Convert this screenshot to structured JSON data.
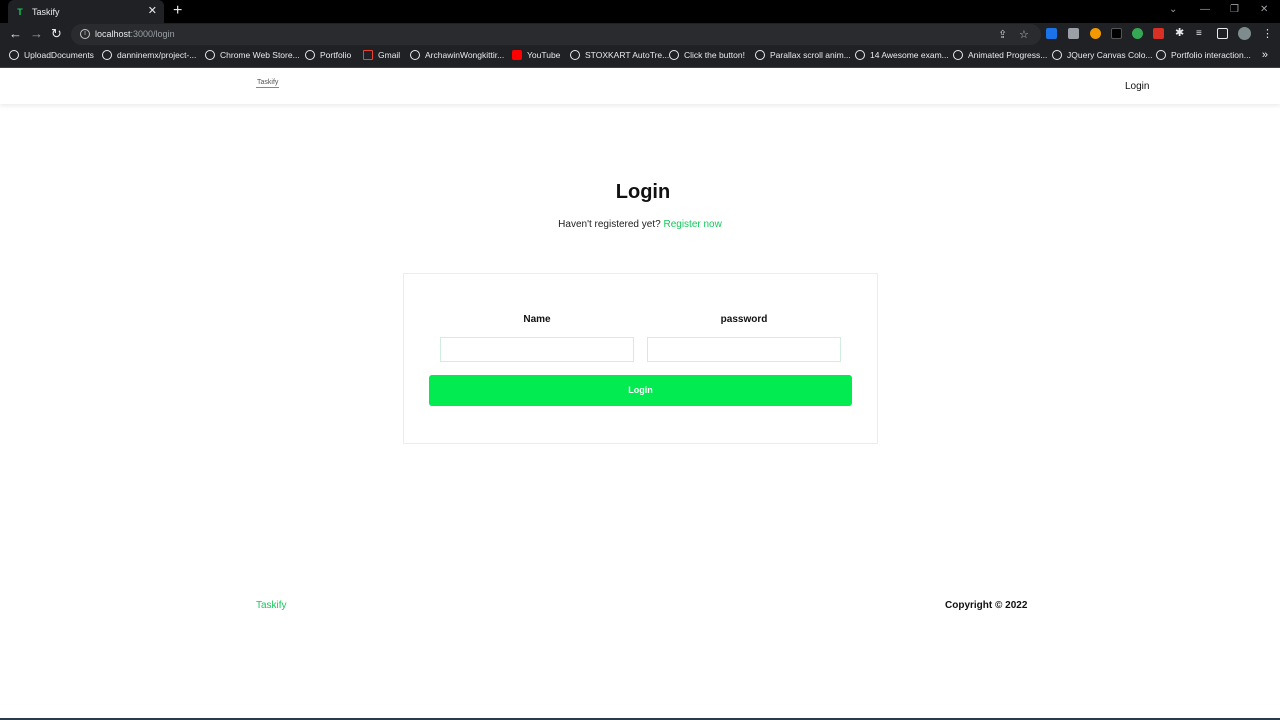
{
  "browser": {
    "tab_title": "Taskify",
    "tab_favicon": "T",
    "tab_close": "✕",
    "new_tab": "+",
    "url_host": "localhost",
    "url_path": ":3000/login",
    "bookmarks": [
      {
        "label": "UploadDocuments",
        "icon": "puzzle-icon"
      },
      {
        "label": "danninemx/project-...",
        "icon": "github-icon"
      },
      {
        "label": "Chrome Web Store...",
        "icon": "store-icon"
      },
      {
        "label": "Portfolio",
        "icon": "page-icon"
      },
      {
        "label": "Gmail",
        "icon": "gmail-icon"
      },
      {
        "label": "ArchawinWongkittir...",
        "icon": "github-icon"
      },
      {
        "label": "YouTube",
        "icon": "youtube-icon"
      },
      {
        "label": "STOXKART AutoTre...",
        "icon": "stoxkart-icon"
      },
      {
        "label": "Click the button!",
        "icon": "page-icon"
      },
      {
        "label": "Parallax scroll anim...",
        "icon": "page-icon"
      },
      {
        "label": "14 Awesome exam...",
        "icon": "page-icon"
      },
      {
        "label": "Animated Progress...",
        "icon": "page-icon"
      },
      {
        "label": "JQuery Canvas Colo...",
        "icon": "page-icon"
      },
      {
        "label": "Portfolio interaction...",
        "icon": "page-icon"
      }
    ],
    "more_bookmarks": "»"
  },
  "nav": {
    "logo_text": "Taskify",
    "login_link": "Login"
  },
  "main": {
    "title": "Login",
    "subtitle_prefix": "Haven't registered yet?",
    "register_link": "Register now",
    "form": {
      "name_label": "Name",
      "password_label": "password",
      "name_value": "",
      "password_value": "",
      "submit_label": "Login"
    }
  },
  "footer": {
    "brand": "Taskify",
    "copyright": "Copyright © 2022"
  },
  "colors": {
    "accent": "#02eb50",
    "link": "#14c95b",
    "chrome_bg": "#202124"
  }
}
